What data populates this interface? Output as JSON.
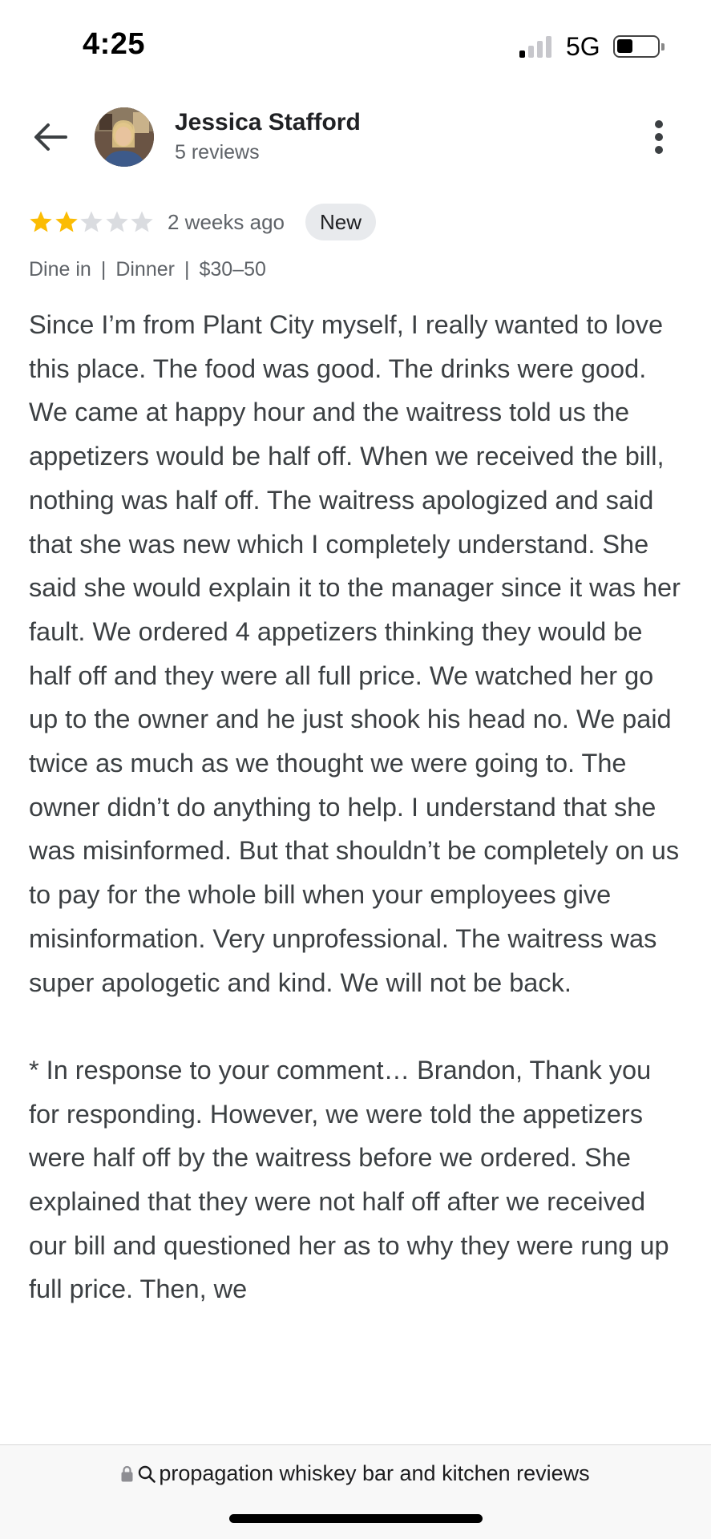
{
  "status_bar": {
    "time": "4:25",
    "network": "5G",
    "signal_bars_active": 1,
    "battery_level": 0.35
  },
  "header": {
    "back_icon": "arrow-left-icon",
    "reviewer_name": "Jessica Stafford",
    "reviewer_count": "5 reviews",
    "more_icon": "more-vertical-icon"
  },
  "review": {
    "rating": 2,
    "max_rating": 5,
    "time_ago": "2 weeks ago",
    "badge": "New",
    "meta": [
      "Dine in",
      "Dinner",
      "$30–50"
    ],
    "paragraphs": [
      "Since I’m from Plant City myself, I really wanted to love this place. The food was good. The drinks were good. We came at happy hour and the waitress told us the appetizers would be half off. When we received the bill, nothing was half off. The waitress apologized and said that she was new which I completely understand. She said she would explain it to the manager since it was her fault. We ordered 4 appetizers thinking they would be half off and they were all full price. We watched her go up to the owner and he just shook his head no. We paid twice as much as we thought we were going to. The owner didn’t do anything to help. I understand that she was misinformed. But that shouldn’t be completely on us to pay for the whole bill when your employees give misinformation. Very unprofessional. The waitress was super apologetic and kind. We will not be back.",
      "* In response to your comment… Brandon, Thank you for responding. However, we were told the appetizers were half off by the waitress before we ordered. She explained that they were not half off after we received our bill and questioned her as to why they were rung up full price. Then, we"
    ]
  },
  "browser": {
    "url_text": "propagation whiskey bar and kitchen reviews"
  },
  "colors": {
    "star_filled": "#fbbc04",
    "star_empty": "#dadce0",
    "text_primary": "#202124",
    "text_secondary": "#5f6368",
    "badge_bg": "#e8eaed"
  }
}
